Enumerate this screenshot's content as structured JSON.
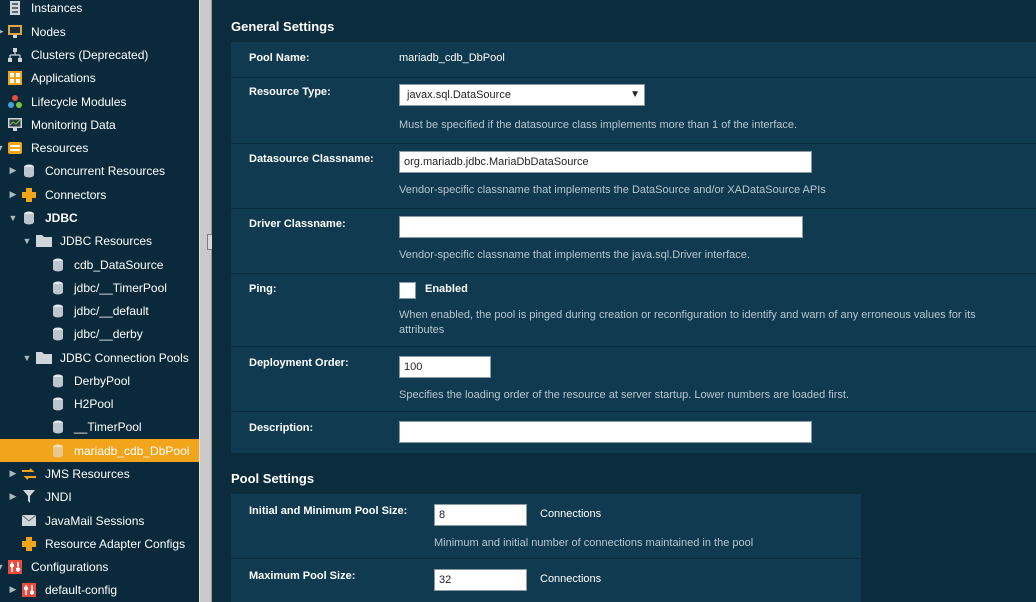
{
  "sidebar": {
    "items": [
      {
        "label": "Instances"
      },
      {
        "label": "Nodes"
      },
      {
        "label": "Clusters (Deprecated)"
      },
      {
        "label": "Applications"
      },
      {
        "label": "Lifecycle Modules"
      },
      {
        "label": "Monitoring Data"
      },
      {
        "label": "Resources"
      },
      {
        "label": "Concurrent Resources"
      },
      {
        "label": "Connectors"
      },
      {
        "label": "JDBC"
      },
      {
        "label": "JDBC Resources"
      },
      {
        "label": "cdb_DataSource"
      },
      {
        "label": "jdbc/__TimerPool"
      },
      {
        "label": "jdbc/__default"
      },
      {
        "label": "jdbc/__derby"
      },
      {
        "label": "JDBC Connection Pools"
      },
      {
        "label": "DerbyPool"
      },
      {
        "label": "H2Pool"
      },
      {
        "label": "__TimerPool"
      },
      {
        "label": "mariadb_cdb_DbPool"
      },
      {
        "label": "JMS Resources"
      },
      {
        "label": "JNDI"
      },
      {
        "label": "JavaMail Sessions"
      },
      {
        "label": "Resource Adapter Configs"
      },
      {
        "label": "Configurations"
      },
      {
        "label": "default-config"
      }
    ]
  },
  "general": {
    "title": "General Settings",
    "pool_name": {
      "label": "Pool Name:",
      "value": "mariadb_cdb_DbPool"
    },
    "resource_type": {
      "label": "Resource Type:",
      "value": "javax.sql.DataSource",
      "help": "Must be specified if the datasource class implements more than 1 of the interface."
    },
    "datasource_classname": {
      "label": "Datasource Classname:",
      "value": "org.mariadb.jdbc.MariaDbDataSource",
      "help": "Vendor-specific classname that implements the DataSource and/or XADataSource APIs"
    },
    "driver_classname": {
      "label": "Driver Classname:",
      "value": "",
      "help": "Vendor-specific classname that implements the java.sql.Driver interface."
    },
    "ping": {
      "label": "Ping:",
      "checkbox_label": "Enabled",
      "help_line1": "When enabled, the pool is pinged during creation or reconfiguration to identify and warn of any erroneous values for its",
      "help_line2": "attributes"
    },
    "deployment_order": {
      "label": "Deployment Order:",
      "value": "100",
      "help": "Specifies the loading order of the resource at server startup. Lower numbers are loaded first."
    },
    "description": {
      "label": "Description:",
      "value": ""
    }
  },
  "pool": {
    "title": "Pool Settings",
    "initial_min": {
      "label": "Initial and Minimum Pool Size:",
      "value": "8",
      "unit": "Connections",
      "help": "Minimum and initial number of connections maintained in the pool"
    },
    "max": {
      "label": "Maximum Pool Size:",
      "value": "32",
      "unit": "Connections"
    }
  },
  "colors": {
    "accent": "#f2a41b",
    "sidebar_bg": "#0a2a3b",
    "panel_bg": "#0f3a50"
  }
}
